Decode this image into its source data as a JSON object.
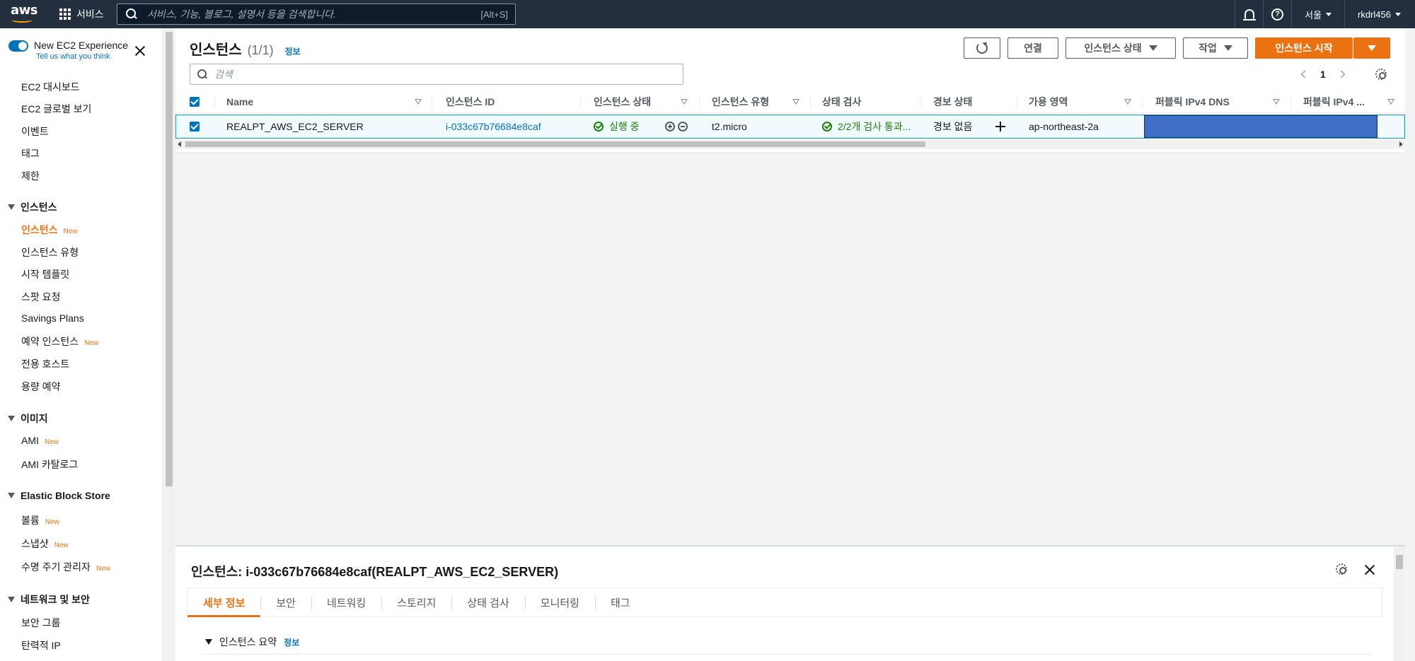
{
  "topnav": {
    "logo_text": "aws",
    "services_label": "서비스",
    "search_placeholder": "서비스, 기능, 블로그, 설명서 등을 검색합니다.",
    "search_shortcut": "[Alt+S]",
    "region": "서울",
    "account": "rkdrl456"
  },
  "sidebar": {
    "toggle_label": "New EC2 Experience",
    "toggle_sub": "Tell us what you think",
    "new_badge": "New",
    "items_top": [
      "EC2 대시보드",
      "EC2 글로벌 보기",
      "이벤트",
      "태그",
      "제한"
    ],
    "sections": [
      {
        "title": "인스턴스",
        "items": [
          "인스턴스",
          "인스턴스 유형",
          "시작 템플릿",
          "스팟 요청",
          "Savings Plans",
          "예약 인스턴스",
          "전용 호스트",
          "용량 예약"
        ]
      },
      {
        "title": "이미지",
        "items": [
          "AMI",
          "AMI 카탈로그"
        ]
      },
      {
        "title": "Elastic Block Store",
        "items": [
          "볼륨",
          "스냅샷",
          "수명 주기 관리자"
        ]
      },
      {
        "title": "네트워크 및 보안",
        "items": [
          "보안 그룹",
          "탄력적 IP"
        ]
      }
    ]
  },
  "main": {
    "title": "인스턴스",
    "count": "(1/1)",
    "info_link": "정보",
    "buttons": {
      "connect": "연결",
      "instance_state": "인스턴스 상태",
      "actions": "작업",
      "launch": "인스턴스 시작"
    },
    "filter_placeholder": "검색",
    "page_number": "1",
    "columns": [
      "Name",
      "인스턴스 ID",
      "인스턴스 상태",
      "인스턴스 유형",
      "상태 검사",
      "경보 상태",
      "가용 영역",
      "퍼블릭 IPv4 DNS",
      "퍼블릭 IPv4 ..."
    ],
    "row": {
      "name": "REALPT_AWS_EC2_SERVER",
      "instance_id": "i-033c67b76684e8caf",
      "state": "실행 중",
      "type": "t2.micro",
      "status_check": "2/2개 검사 통과...",
      "alarm": "경보 없음",
      "az": "ap-northeast-2a"
    }
  },
  "detail": {
    "title": "인스턴스: i-033c67b76684e8caf(REALPT_AWS_EC2_SERVER)",
    "tabs": [
      "세부 정보",
      "보안",
      "네트워킹",
      "스토리지",
      "상태 검사",
      "모니터링",
      "태그"
    ],
    "section_title": "인스턴스 요약",
    "section_info": "정보"
  }
}
